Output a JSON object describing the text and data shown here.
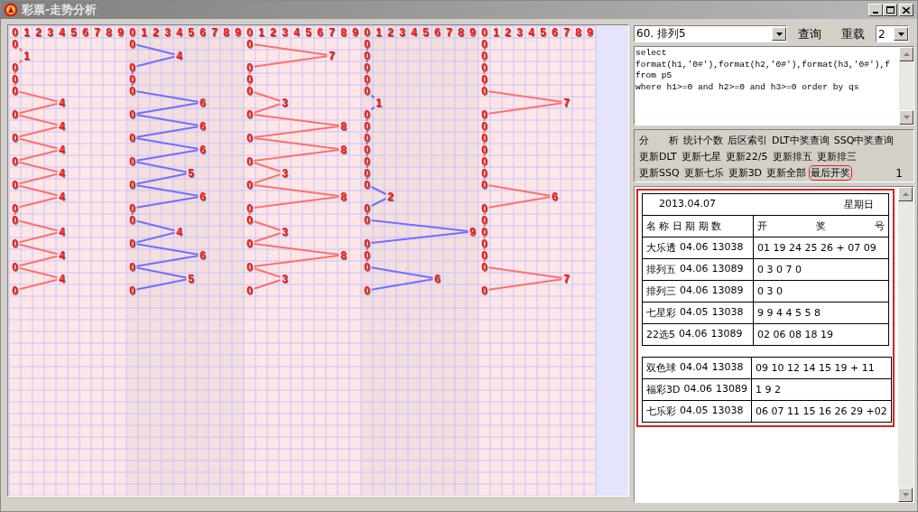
{
  "window": {
    "title": "彩票-走势分析"
  },
  "trend": {
    "groups": [
      {
        "color": "#ff7070",
        "digits": [
          "0",
          "1",
          "2",
          "3",
          "4",
          "5",
          "6",
          "7",
          "8",
          "9"
        ],
        "values": [
          "0",
          "1",
          "0",
          "0",
          "0",
          "4",
          "0",
          "4",
          "0",
          "4",
          "0",
          "4",
          "0",
          "4",
          "0",
          "0",
          "4",
          "0",
          "4",
          "0",
          "4",
          "0"
        ]
      },
      {
        "color": "#7070ff",
        "digits": [
          "0",
          "1",
          "2",
          "3",
          "4",
          "5",
          "6",
          "7",
          "8",
          "9"
        ],
        "values": [
          "0",
          "4",
          "0",
          "0",
          "0",
          "6",
          "0",
          "6",
          "0",
          "6",
          "0",
          "5",
          "0",
          "6",
          "0",
          "0",
          "4",
          "0",
          "6",
          "0",
          "5",
          "0"
        ]
      },
      {
        "color": "#ff7070",
        "digits": [
          "0",
          "1",
          "2",
          "3",
          "4",
          "5",
          "6",
          "7",
          "8",
          "9"
        ],
        "values": [
          "0",
          "7",
          "0",
          "0",
          "0",
          "3",
          "0",
          "8",
          "0",
          "8",
          "0",
          "3",
          "0",
          "8",
          "0",
          "0",
          "3",
          "0",
          "8",
          "0",
          "3",
          "0"
        ]
      },
      {
        "color": "#7070ff",
        "digits": [
          "0",
          "1",
          "2",
          "3",
          "4",
          "5",
          "6",
          "7",
          "8",
          "9"
        ],
        "values": [
          "0",
          "0",
          "0",
          "0",
          "0",
          "1",
          "0",
          "0",
          "0",
          "0",
          "0",
          "0",
          "0",
          "2",
          "0",
          "0",
          "9",
          "0",
          "0",
          "0",
          "6",
          "0"
        ]
      },
      {
        "color": "#ff7070",
        "digits": [
          "0",
          "1",
          "2",
          "3",
          "4",
          "5",
          "6",
          "7",
          "8",
          "9"
        ],
        "values": [
          "0",
          "0",
          "0",
          "0",
          "0",
          "7",
          "0",
          "0",
          "0",
          "0",
          "0",
          "0",
          "0",
          "6",
          "0",
          "0",
          "0",
          "0",
          "0",
          "0",
          "7",
          "0"
        ]
      }
    ]
  },
  "query": {
    "lottery": "60. 排列5",
    "query_button": "查询",
    "reload_button": "重载",
    "count": "2"
  },
  "sql": [
    "select",
    "format(h1,'0#'),format(h2,'0#'),format(h3,'0#'),f",
    "from p5",
    "where h1>=0 and h2>=0 and h3>=0 order by qs"
  ],
  "action_rows": [
    [
      {
        "label": "分　　析",
        "selected": false
      },
      {
        "label": "统计个数",
        "selected": false
      },
      {
        "label": "后区索引",
        "selected": false
      },
      {
        "label": "DLT中奖查询",
        "selected": false
      },
      {
        "label": "SSQ中奖查询",
        "selected": false
      }
    ],
    [
      {
        "label": "更新DLT",
        "selected": false
      },
      {
        "label": "更新七星",
        "selected": false
      },
      {
        "label": "更新22/5",
        "selected": false
      },
      {
        "label": "更新排五",
        "selected": false
      },
      {
        "label": "更新排三",
        "selected": false
      }
    ],
    [
      {
        "label": "更新SSQ",
        "selected": false
      },
      {
        "label": "更新七乐",
        "selected": false
      },
      {
        "label": "更新3D",
        "selected": false
      },
      {
        "label": "更新全部",
        "selected": false
      },
      {
        "label": "最后开奖",
        "selected": true
      }
    ]
  ],
  "result_count": "1",
  "results": {
    "date": "2013.04.07",
    "weekday": "星期日",
    "header_left": "名 称 日 期 期 数",
    "header_right": [
      "开",
      "奖",
      "号"
    ],
    "groups": [
      [
        {
          "name": "大乐透",
          "date": "04.06",
          "issue": "13038",
          "numbers": "01 19 24 25 26 + 07 09"
        },
        {
          "name": "排列五",
          "date": "04.06",
          "issue": "13089",
          "numbers": "0 3 0 7 0"
        },
        {
          "name": "排列三",
          "date": "04.06",
          "issue": "13089",
          "numbers": "0 3 0"
        },
        {
          "name": "七星彩",
          "date": "04.05",
          "issue": "13038",
          "numbers": "9 9 4 4 5 5 8"
        },
        {
          "name": "22选5",
          "date": "04.06",
          "issue": "13089",
          "numbers": "02 06 08 18 19"
        }
      ],
      [
        {
          "name": "双色球",
          "date": "04.04",
          "issue": "13038",
          "numbers": "09 10 12 14 15 19 + 11"
        },
        {
          "name": "福彩3D",
          "date": "04.06",
          "issue": "13089",
          "numbers": "1 9 2"
        },
        {
          "name": "七乐彩",
          "date": "04.05",
          "issue": "13038",
          "numbers": "06 07 11 15 16 26 29 +02"
        }
      ]
    ]
  }
}
